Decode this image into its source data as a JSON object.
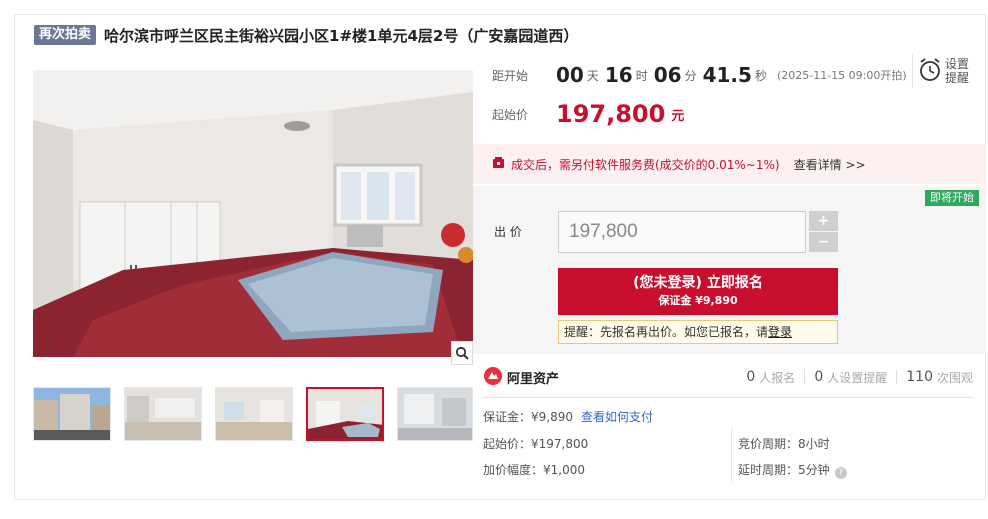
{
  "header": {
    "tag": "再次拍卖",
    "title": "哈尔滨市呼兰区民主街裕兴园小区1#楼1单元4层2号（广安嘉园道西）"
  },
  "countdown": {
    "label": "距开始",
    "days": "00",
    "days_unit": "天",
    "hours": "16",
    "hours_unit": "时",
    "minutes": "06",
    "minutes_unit": "分",
    "seconds": "41.5",
    "seconds_unit": "秒",
    "start_time": "(2025-11-15 09:00开拍)"
  },
  "remind": {
    "line1": "设置",
    "line2": "提醒",
    "icon": "alarm-clock-icon"
  },
  "start_price": {
    "label": "起始价",
    "value": "197,800",
    "unit": "元"
  },
  "fee_notice": {
    "text": "成交后，需另付软件服务费(成交价的0.01%~1%)",
    "link": "查看详情 >>"
  },
  "bid": {
    "status_badge": "即将开始",
    "label": "出  价",
    "value": "197,800",
    "plus": "+",
    "minus": "−",
    "signup_main": "(您未登录) 立即报名",
    "signup_sub": "保证金 ¥9,890",
    "tip_prefix": "提醒：先报名再出价。如您已报名，请",
    "tip_link": "登录"
  },
  "brand": {
    "name": "阿里资产"
  },
  "stats": [
    {
      "num": "0",
      "label": "人报名"
    },
    {
      "num": "0",
      "label": "人设置提醒"
    },
    {
      "num": "110",
      "label": "次围观"
    }
  ],
  "info": {
    "deposit_label": "保证金：¥9,890",
    "deposit_link": "查看如何支付",
    "start_price": "起始价：¥197,800",
    "increment": "加价幅度：¥1,000",
    "bid_period": "竞价周期：8小时",
    "extension": "延时周期：5分钟"
  },
  "colors": {
    "accent": "#c8102e",
    "tag_bg": "#6b7894",
    "badge_green": "#32a85c",
    "link": "#3366cc"
  }
}
